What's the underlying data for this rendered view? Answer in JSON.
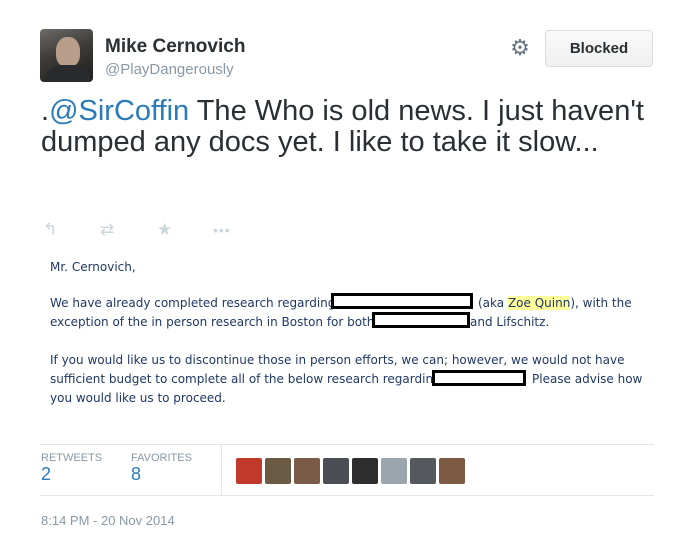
{
  "author": {
    "name": "Mike Cernovich",
    "handle": "@PlayDangerously"
  },
  "header": {
    "blocked_label": "Blocked"
  },
  "tweet": {
    "prefix": ".",
    "mention": "@SirCoffin",
    "text": " The Who is old news. I just haven't dumped any docs yet. I like to take it slow..."
  },
  "actions": {
    "reply_icon": "↰",
    "retweet_icon": "⇄",
    "favorite_icon": "★",
    "more_icon": "•••"
  },
  "document": {
    "salutation": "Mr. Cernovich,",
    "p1_line1_a": "We have already completed research regarding",
    "p1_line1_b": "(aka ",
    "p1_name": "Zoe Quinn",
    "p1_line1_c": "), with the",
    "p1_line2_a": "exception of the in person research in Boston for both",
    "p1_line2_b": "and Lifschitz.",
    "p2_line1": "If you would like us to discontinue those in person efforts, we can; however, we would not have",
    "p2_line2_a": "sufficient budget to complete all of the below research regarding",
    "p2_line2_b": "Please advise how",
    "p2_line3": "you would like us to proceed."
  },
  "stats": {
    "retweets_label": "RETWEETS",
    "retweets_value": "2",
    "favorites_label": "FAVORITES",
    "favorites_value": "8"
  },
  "favoriters": [
    {
      "name": "avatar-1",
      "color": "#c0392b"
    },
    {
      "name": "avatar-2",
      "color": "#6b5a44"
    },
    {
      "name": "avatar-3",
      "color": "#7a5b48"
    },
    {
      "name": "avatar-4",
      "color": "#4b4f55"
    },
    {
      "name": "avatar-5",
      "color": "#2e2e2e"
    },
    {
      "name": "avatar-6",
      "color": "#9aa5ad"
    },
    {
      "name": "avatar-7",
      "color": "#55585c"
    },
    {
      "name": "avatar-8",
      "color": "#7d5a43"
    }
  ],
  "timestamp": "8:14 PM - 20 Nov 2014"
}
